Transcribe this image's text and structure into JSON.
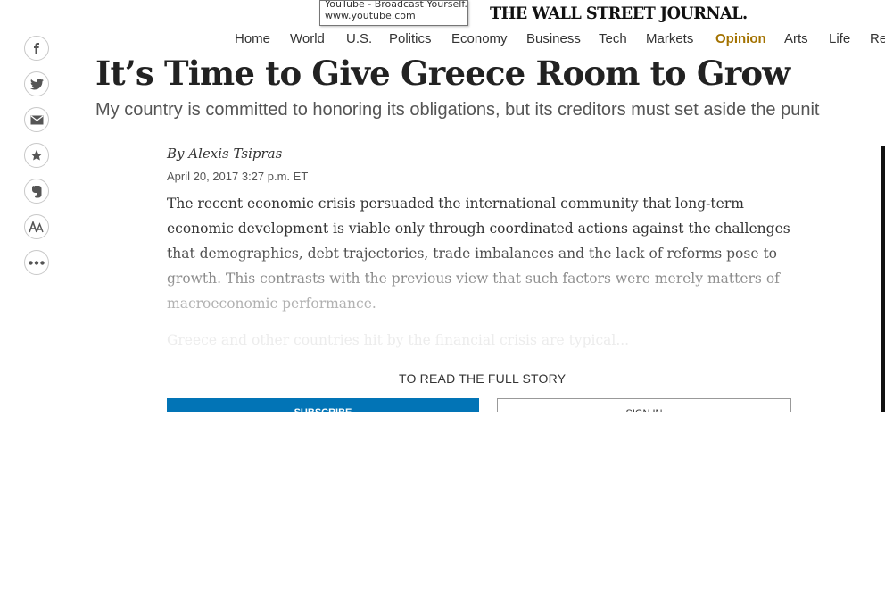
{
  "tooltip": {
    "title": "YouTube - Broadcast Yourself.",
    "url": "www.youtube.com"
  },
  "masthead": {
    "logo": "THE WALL STREET JOURNAL."
  },
  "nav": {
    "items": [
      {
        "label": "Home"
      },
      {
        "label": "World"
      },
      {
        "label": "U.S."
      },
      {
        "label": "Politics"
      },
      {
        "label": "Economy"
      },
      {
        "label": "Business"
      },
      {
        "label": "Tech"
      },
      {
        "label": "Markets"
      },
      {
        "label": "Opinion",
        "active": true
      },
      {
        "label": "Arts"
      },
      {
        "label": "Life"
      },
      {
        "label": "Re"
      }
    ],
    "active_color": "#a37200"
  },
  "share_rail": {
    "icons": [
      "facebook-icon",
      "twitter-icon",
      "email-icon",
      "save-star-icon",
      "evernote-icon",
      "text-size-icon",
      "more-icon"
    ]
  },
  "article": {
    "headline": "It’s Time to Give Greece Room to Grow",
    "dek": "My country is committed to honoring its obligations, but its creditors must set aside the punit",
    "byline": "By Alexis Tsipras",
    "timestamp": "April 20, 2017 3:27 p.m. ET",
    "paragraph1": "The recent economic crisis persuaded the international community that long-term economic development is viable only through coordinated actions against the challenges that demographics, debt trajectories, trade imbalances and the lack of reforms pose to growth. This contrasts with the previous view that such factors were merely matters of macroeconomic performance.",
    "paragraph2_teaser": "Greece and other countries hit by the financial crisis are typical..."
  },
  "paywall": {
    "prompt": "TO READ THE FULL STORY",
    "subscribe_label": "SUBSCRIBE",
    "signin_label": "SIGN IN",
    "subscribe_color": "#0274b6"
  }
}
